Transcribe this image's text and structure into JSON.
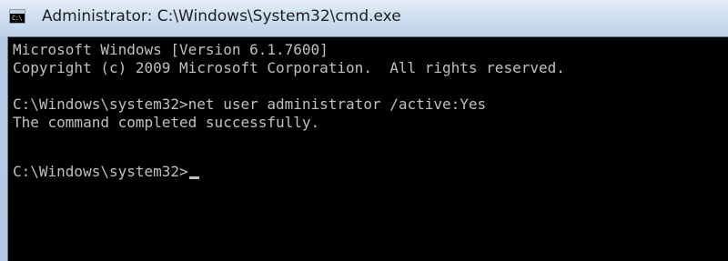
{
  "window": {
    "title": "Administrator: C:\\Windows\\System32\\cmd.exe",
    "icon": "cmd-icon",
    "icon_glyph": "C:\\"
  },
  "console": {
    "lines": [
      "Microsoft Windows [Version 6.1.7600]",
      "Copyright (c) 2009 Microsoft Corporation.  All rights reserved.",
      "",
      "C:\\Windows\\system32>net user administrator /active:Yes",
      "The command completed successfully.",
      ""
    ],
    "prompt": "C:\\Windows\\system32>",
    "colors": {
      "background": "#000000",
      "text": "#c0c0c0"
    }
  }
}
